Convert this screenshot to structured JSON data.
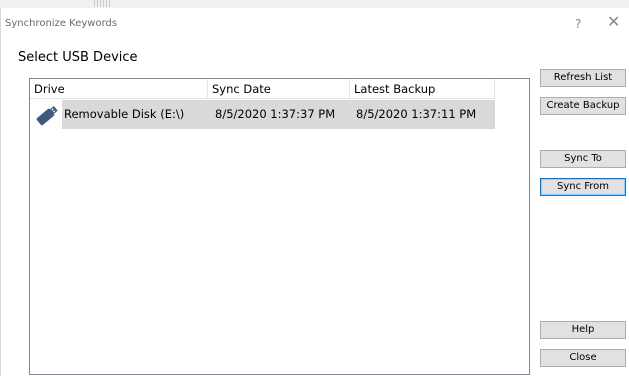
{
  "window": {
    "title": "Synchronize Keywords",
    "help_glyph": "?",
    "close_glyph": "✕"
  },
  "section_label": "Select USB Device",
  "table": {
    "columns": [
      "Drive",
      "Sync Date",
      "Latest Backup"
    ],
    "rows": [
      {
        "icon": "usb-drive-icon",
        "drive": "Removable Disk (E:\\)",
        "sync_date": "8/5/2020 1:37:37 PM",
        "latest_backup": "8/5/2020 1:37:11 PM",
        "selected": true
      }
    ]
  },
  "buttons": {
    "refresh": "Refresh List",
    "create_backup": "Create Backup",
    "sync_to": "Sync To",
    "sync_from": "Sync From",
    "help": "Help",
    "close": "Close"
  },
  "colors": {
    "selected_row": "#d9d9d9",
    "button_face": "#e1e1e1",
    "focus_border": "#0078d7",
    "usb_icon": "#3c5a7d"
  }
}
